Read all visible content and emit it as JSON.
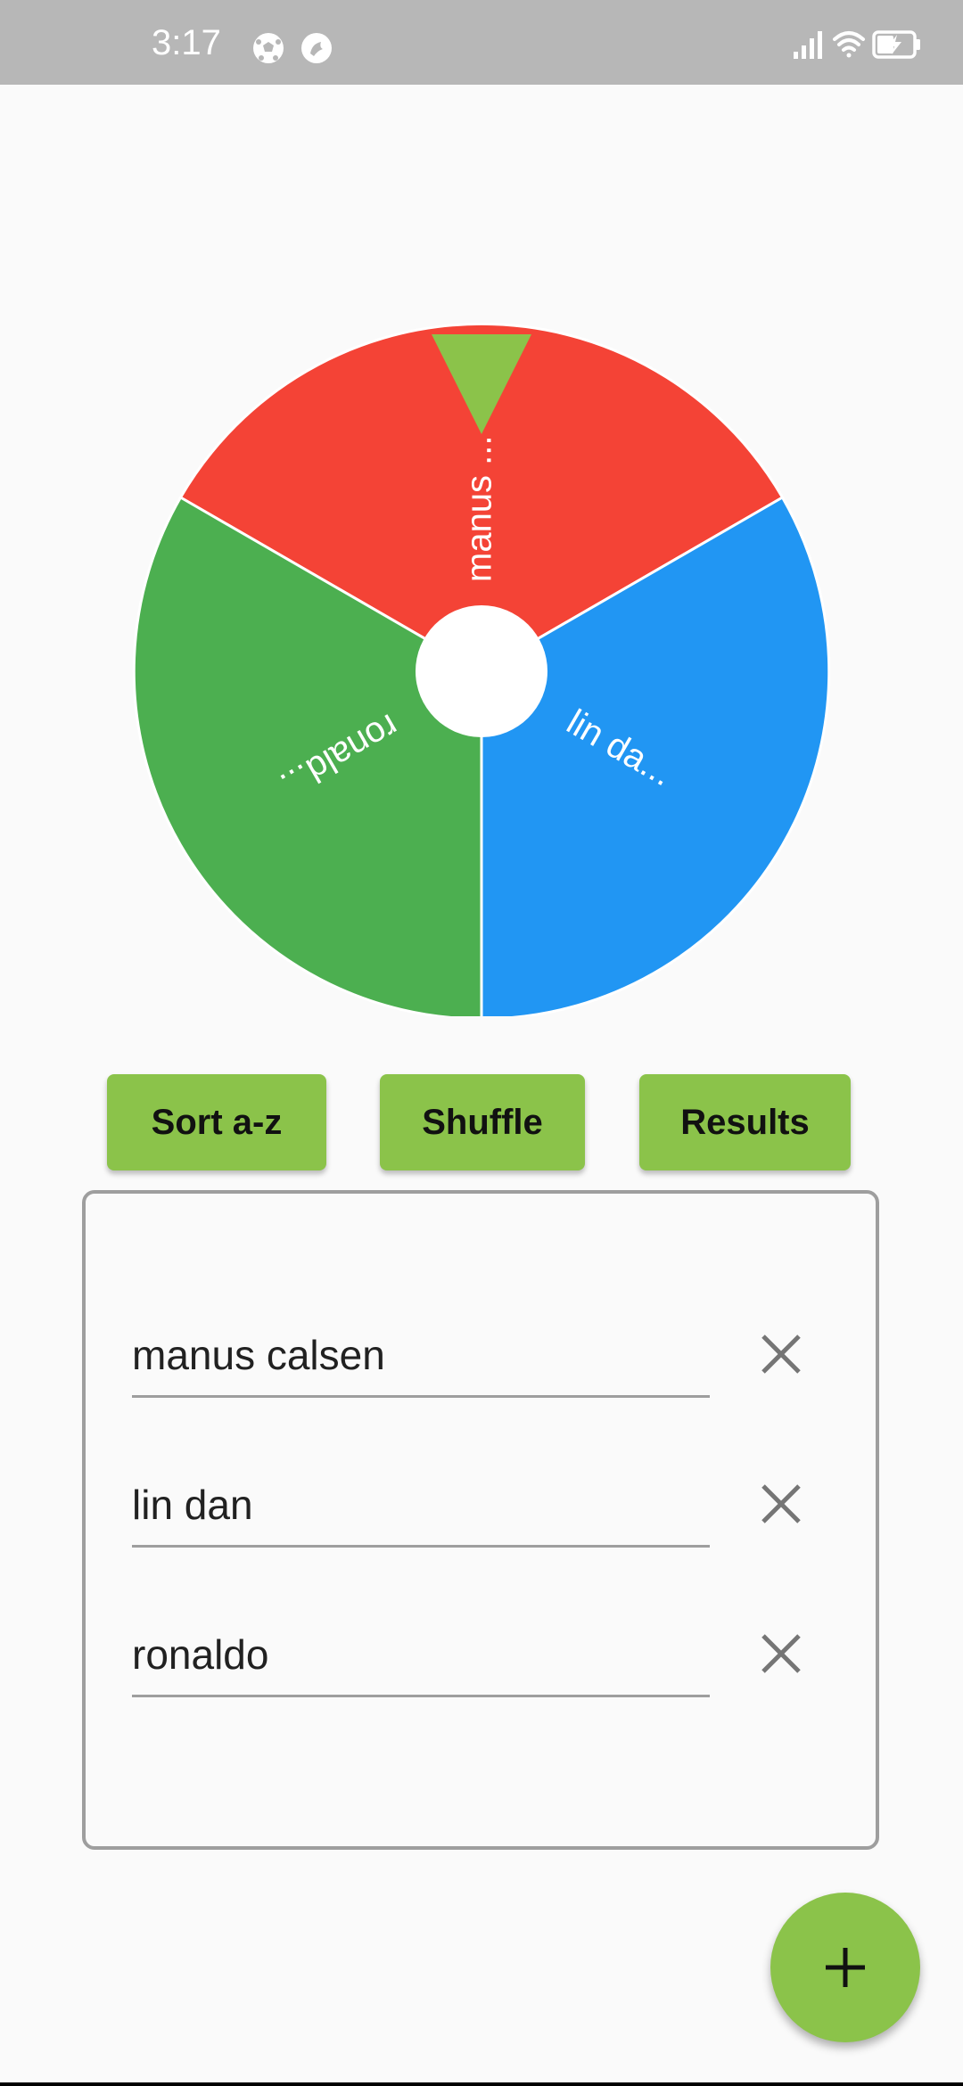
{
  "status_bar": {
    "time": "3:17",
    "icons": [
      "soccer-ball-icon",
      "app-notification-icon",
      "signal-icon",
      "wifi-icon",
      "battery-charging-icon"
    ]
  },
  "wheel": {
    "segments": [
      {
        "label": "manus ...",
        "color": "#f44336"
      },
      {
        "label": "lin da...",
        "color": "#2196f3"
      },
      {
        "label": "ronald...",
        "color": "#4caf50"
      }
    ],
    "pointer_color": "#8bc34a",
    "center_color": "#ffffff"
  },
  "buttons": {
    "sort": "Sort a-z",
    "shuffle": "Shuffle",
    "results": "Results"
  },
  "entries": [
    {
      "value": "manus calsen"
    },
    {
      "value": "lin dan"
    },
    {
      "value": "ronaldo"
    }
  ],
  "fab": {
    "icon": "plus-icon"
  },
  "colors": {
    "accent": "#8bc34a",
    "background": "#fafafa",
    "status_bar": "#b7b7b7",
    "border": "#9e9e9e"
  }
}
